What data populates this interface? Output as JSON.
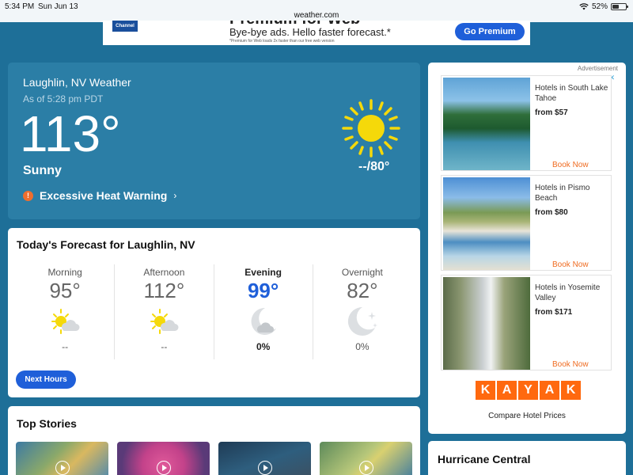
{
  "status": {
    "time": "5:34 PM",
    "date": "Sun Jun 13",
    "url": "weather.com",
    "battery": "52%",
    "battery_level": 0.52
  },
  "top_ad": {
    "logo_text": "Channel",
    "headline": "Premium for Web",
    "tagline": "Bye-bye ads. Hello faster forecast.*",
    "fine_print": "*Premium for Web loads 2x faster than our free web version",
    "button": "Go Premium"
  },
  "current": {
    "location": "Laughlin, NV Weather",
    "as_of": "As of 5:28 pm PDT",
    "temperature": "113°",
    "phrase": "Sunny",
    "hi_lo": "--/80°",
    "alert": "Excessive Heat Warning",
    "alert_icon": "!",
    "icon": "sun-icon"
  },
  "today": {
    "title": "Today's Forecast for Laughlin, NV",
    "periods": [
      {
        "label": "Morning",
        "temp": "95°",
        "precip": "--",
        "icon": "partly-cloudy-day-icon"
      },
      {
        "label": "Afternoon",
        "temp": "112°",
        "precip": "--",
        "icon": "partly-cloudy-day-icon"
      },
      {
        "label": "Evening",
        "temp": "99°",
        "precip": "0%",
        "icon": "partly-cloudy-night-icon"
      },
      {
        "label": "Overnight",
        "temp": "82°",
        "precip": "0%",
        "icon": "clear-night-icon"
      }
    ],
    "next_button": "Next Hours"
  },
  "stories": {
    "title": "Top Stories"
  },
  "ad_column": {
    "advertisement": "Advertisement",
    "hotels": [
      {
        "name": "Hotels in South Lake Tahoe",
        "price": "from $57",
        "cta": "Book Now"
      },
      {
        "name": "Hotels in Pismo Beach",
        "price": "from $80",
        "cta": "Book Now"
      },
      {
        "name": "Hotels in Yosemite Valley",
        "price": "from $171",
        "cta": "Book Now"
      }
    ],
    "brand_letters": [
      "K",
      "A",
      "Y",
      "A",
      "K"
    ],
    "compare": "Compare Hotel Prices"
  },
  "hurricane": {
    "title": "Hurricane Central"
  },
  "colors": {
    "page_bg": "#1e6f98",
    "current_card": "#2b7ea6",
    "accent_blue": "#1f5fd9",
    "warning_orange": "#ef6e2e",
    "kayak_orange": "#ff690f"
  }
}
